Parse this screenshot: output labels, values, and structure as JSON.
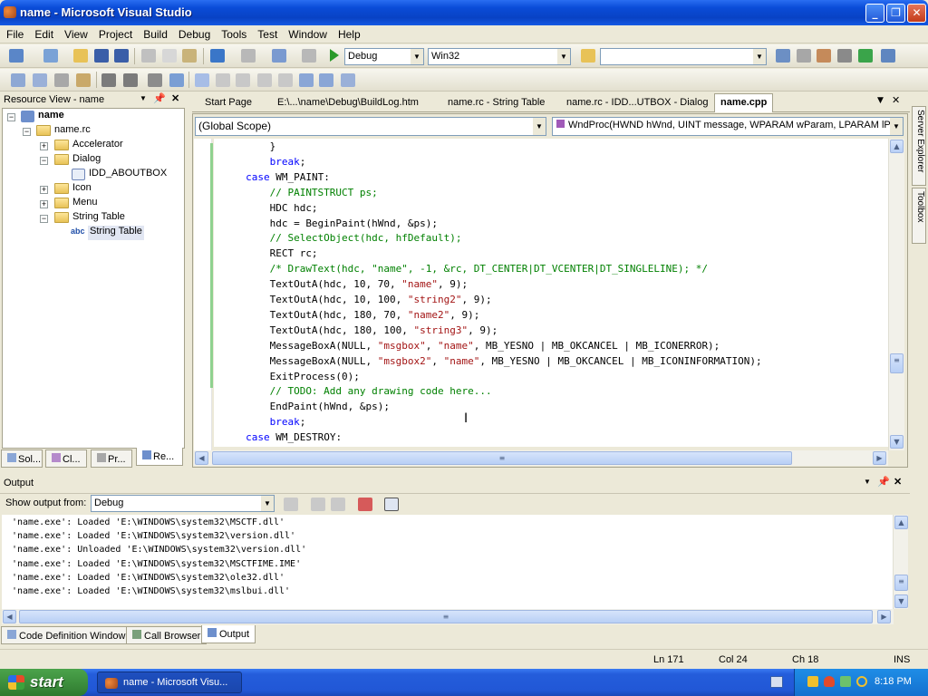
{
  "window": {
    "title": "name - Microsoft Visual Studio"
  },
  "menu": [
    "File",
    "Edit",
    "View",
    "Project",
    "Build",
    "Debug",
    "Tools",
    "Test",
    "Window",
    "Help"
  ],
  "toolbar": {
    "config": "Debug",
    "platform": "Win32",
    "find_box": ""
  },
  "resource_view": {
    "title": "Resource View - name",
    "root": "name",
    "rc": "name.rc",
    "nodes": [
      {
        "label": "Accelerator",
        "expanded": false
      },
      {
        "label": "Dialog",
        "expanded": true
      },
      {
        "label": "IDD_ABOUTBOX",
        "child": true
      },
      {
        "label": "Icon",
        "expanded": false
      },
      {
        "label": "Menu",
        "expanded": false
      },
      {
        "label": "String Table",
        "expanded": true
      },
      {
        "label": "String Table",
        "child": true,
        "selected": true
      }
    ],
    "bottom_tabs": [
      "Sol...",
      "Cl...",
      "Pr...",
      "Re..."
    ]
  },
  "doc_tabs": [
    "Start Page",
    "E:\\...\\name\\Debug\\BuildLog.htm",
    "name.rc - String Table",
    "name.rc - IDD...UTBOX - Dialog",
    "name.cpp"
  ],
  "scope_combo": "(Global Scope)",
  "member_combo": "WndProc(HWND hWnd, UINT message, WPARAM wParam, LPARAM lPara",
  "right_strip": {
    "server": "Server Explorer",
    "toolbox": "Toolbox"
  },
  "code_lines": [
    {
      "indent": 9,
      "parts": [
        {
          "t": "}",
          "c": ""
        }
      ]
    },
    {
      "indent": 9,
      "parts": [
        {
          "t": "break",
          "c": "kw"
        },
        {
          "t": ";",
          "c": ""
        }
      ]
    },
    {
      "indent": 5,
      "parts": [
        {
          "t": "case",
          "c": "kw"
        },
        {
          "t": " WM_PAINT:",
          "c": ""
        }
      ]
    },
    {
      "indent": 9,
      "parts": [
        {
          "t": "// PAINTSTRUCT ps;",
          "c": "cm"
        }
      ]
    },
    {
      "indent": 9,
      "parts": [
        {
          "t": "HDC hdc;",
          "c": ""
        }
      ]
    },
    {
      "indent": 9,
      "parts": [
        {
          "t": "hdc = BeginPaint(hWnd, &ps);",
          "c": ""
        }
      ]
    },
    {
      "indent": 9,
      "parts": [
        {
          "t": "// SelectObject(hdc, hfDefault);",
          "c": "cm"
        }
      ]
    },
    {
      "indent": 9,
      "parts": [
        {
          "t": "RECT rc;",
          "c": ""
        }
      ]
    },
    {
      "indent": 9,
      "parts": [
        {
          "t": "/* DrawText(hdc, \"name\", -1, &rc, DT_CENTER|DT_VCENTER|DT_SINGLELINE); */",
          "c": "cm"
        }
      ]
    },
    {
      "indent": 9,
      "parts": [
        {
          "t": "TextOutA(hdc, 10, 70, ",
          "c": ""
        },
        {
          "t": "\"name\"",
          "c": "st"
        },
        {
          "t": ", 9);",
          "c": ""
        }
      ]
    },
    {
      "indent": 9,
      "parts": [
        {
          "t": "TextOutA(hdc, 10, 100, ",
          "c": ""
        },
        {
          "t": "\"string2\"",
          "c": "st"
        },
        {
          "t": ", 9);",
          "c": ""
        }
      ]
    },
    {
      "indent": 9,
      "parts": [
        {
          "t": "TextOutA(hdc, 180, 70, ",
          "c": ""
        },
        {
          "t": "\"name2\"",
          "c": "st"
        },
        {
          "t": ", 9);",
          "c": ""
        }
      ]
    },
    {
      "indent": 9,
      "parts": [
        {
          "t": "TextOutA(hdc, 180, 100, ",
          "c": ""
        },
        {
          "t": "\"string3\"",
          "c": "st"
        },
        {
          "t": ", 9);",
          "c": ""
        }
      ]
    },
    {
      "indent": 9,
      "parts": [
        {
          "t": "MessageBoxA(NULL, ",
          "c": ""
        },
        {
          "t": "\"msgbox\"",
          "c": "st"
        },
        {
          "t": ", ",
          "c": ""
        },
        {
          "t": "\"name\"",
          "c": "st"
        },
        {
          "t": ", MB_YESNO | MB_OKCANCEL | MB_ICONERROR);",
          "c": ""
        }
      ]
    },
    {
      "indent": 9,
      "parts": [
        {
          "t": "MessageBoxA(NULL, ",
          "c": ""
        },
        {
          "t": "\"msgbox2\"",
          "c": "st"
        },
        {
          "t": ", ",
          "c": ""
        },
        {
          "t": "\"name\"",
          "c": "st"
        },
        {
          "t": ", MB_YESNO | MB_OKCANCEL | MB_ICONINFORMATION);",
          "c": ""
        }
      ]
    },
    {
      "indent": 9,
      "parts": [
        {
          "t": "ExitProcess(0);",
          "c": ""
        }
      ]
    },
    {
      "indent": 9,
      "parts": [
        {
          "t": "// TODO: Add any drawing code here...",
          "c": "cm"
        }
      ]
    },
    {
      "indent": 9,
      "parts": [
        {
          "t": "EndPaint(hWnd, &ps);",
          "c": ""
        }
      ]
    },
    {
      "indent": 9,
      "parts": [
        {
          "t": "break",
          "c": "kw"
        },
        {
          "t": ";",
          "c": ""
        }
      ]
    },
    {
      "indent": 5,
      "parts": [
        {
          "t": "case",
          "c": "kw"
        },
        {
          "t": " WM_DESTROY:",
          "c": ""
        }
      ]
    }
  ],
  "output": {
    "title": "Output",
    "show_from_label": "Show output from:",
    "show_from_value": "Debug",
    "lines": [
      "'name.exe': Loaded 'E:\\WINDOWS\\system32\\MSCTF.dll'",
      "'name.exe': Loaded 'E:\\WINDOWS\\system32\\version.dll'",
      "'name.exe': Unloaded 'E:\\WINDOWS\\system32\\version.dll'",
      "'name.exe': Loaded 'E:\\WINDOWS\\system32\\MSCTFIME.IME'",
      "'name.exe': Loaded 'E:\\WINDOWS\\system32\\ole32.dll'",
      "'name.exe': Loaded 'E:\\WINDOWS\\system32\\mslbui.dll'"
    ],
    "bottom_tabs": [
      "Code Definition Window",
      "Call Browser",
      "Output"
    ]
  },
  "status": {
    "ln": "Ln 171",
    "col": "Col 24",
    "ch": "Ch 18",
    "mode": "INS"
  },
  "taskbar": {
    "start": "start",
    "item": "name - Microsoft Visu...",
    "clock": "8:18 PM"
  },
  "colors": {
    "title_blue": "#0a4cd8",
    "keyword": "#0000ff",
    "comment": "#008000",
    "string": "#a31515",
    "start_green": "#3d8f3d"
  }
}
